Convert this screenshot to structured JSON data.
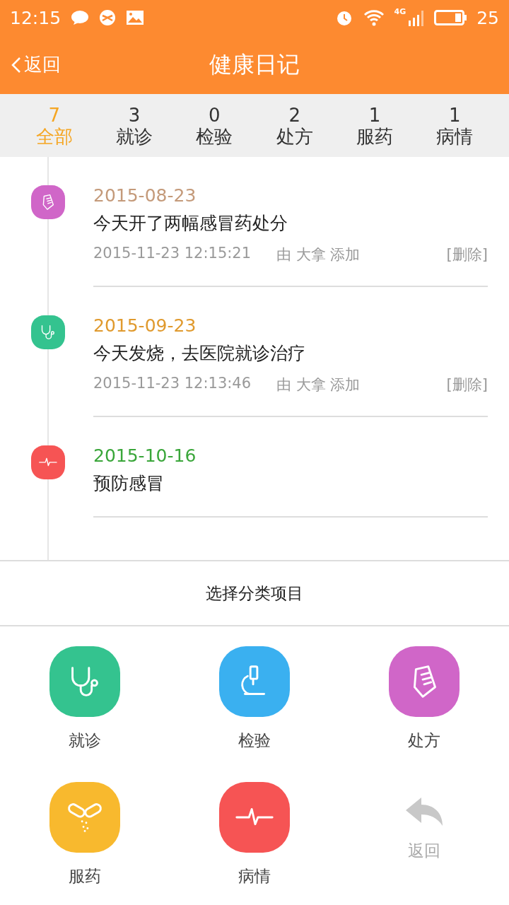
{
  "status_bar": {
    "time": "12:15",
    "network": "4G",
    "battery": "25"
  },
  "header": {
    "back": "返回",
    "title": "健康日记"
  },
  "tabs": [
    {
      "count": "7",
      "label": "全部",
      "selected": true
    },
    {
      "count": "3",
      "label": "就诊",
      "selected": false
    },
    {
      "count": "0",
      "label": "检验",
      "selected": false
    },
    {
      "count": "2",
      "label": "处方",
      "selected": false
    },
    {
      "count": "1",
      "label": "服药",
      "selected": false
    },
    {
      "count": "1",
      "label": "病情",
      "selected": false
    }
  ],
  "entries": [
    {
      "kind": "prescription",
      "date": "2015-08-23",
      "color": "#c49a7a",
      "text": "今天开了两幅感冒药处分",
      "added": "2015-11-23 12:15:21",
      "by": "由 大拿 添加",
      "delete": "[删除]"
    },
    {
      "kind": "visit",
      "date": "2015-09-23",
      "color": "#e09a2e",
      "text": "今天发烧，去医院就诊治疗",
      "added": "2015-11-23 12:13:46",
      "by": "由 大拿 添加",
      "delete": "[删除]"
    },
    {
      "kind": "condition",
      "date": "2015-10-16",
      "color": "#3aa63a",
      "text": "预防感冒"
    }
  ],
  "sheet": {
    "title": "选择分类项目",
    "items": [
      {
        "kind": "visit",
        "label": "就诊"
      },
      {
        "kind": "lab",
        "label": "检验"
      },
      {
        "kind": "prescription",
        "label": "处方"
      },
      {
        "kind": "medication",
        "label": "服药"
      },
      {
        "kind": "condition",
        "label": "病情"
      },
      {
        "kind": "back",
        "label": "返回"
      }
    ]
  }
}
